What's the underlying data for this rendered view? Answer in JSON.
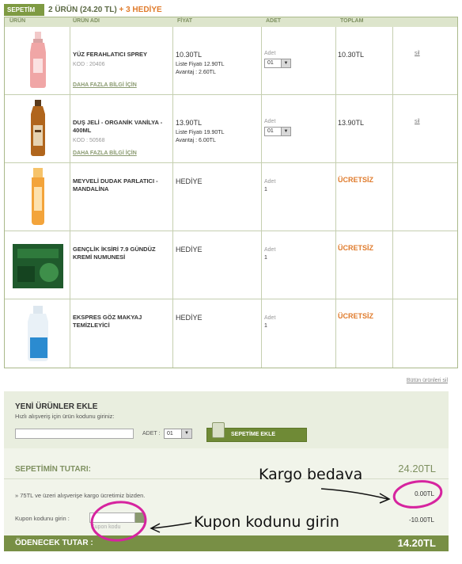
{
  "cart_header": {
    "tag": "SEPETİM",
    "count_text": "2 ÜRÜN (24.20 TL)",
    "gift_text": " + 3 HEDİYE"
  },
  "columns": {
    "product": "ÜRÜN",
    "product_name": "ÜRÜN ADI",
    "price": "FİYAT",
    "quantity": "ADET",
    "total": "TOPLAM"
  },
  "items": [
    {
      "name": "YÜZ FERAHLATICI SPREY",
      "code": "KOD : 20406",
      "more": "DAHA FAZLA BİLGİ İÇİN",
      "price": "10.30TL",
      "list_price": "Liste Fiyatı 12.90TL",
      "advantage": "Avantaj : 2.60TL",
      "qty_label": "Adet",
      "qty": "01",
      "total": "10.30TL",
      "delete": "sil"
    },
    {
      "name": "DUŞ JELİ - ORGANİK VANİLYA - 400ML",
      "code": "KOD : 50568",
      "more": "DAHA FAZLA BİLGİ İÇİN",
      "price": "13.90TL",
      "list_price": "Liste Fiyatı 19.90TL",
      "advantage": "Avantaj : 6.00TL",
      "qty_label": "Adet",
      "qty": "01",
      "total": "13.90TL",
      "delete": "sil"
    },
    {
      "name": "MEYVELİ DUDAK PARLATICI - MANDALİNA",
      "price": "HEDİYE",
      "qty_label": "Adet",
      "qty": "1",
      "total": "ÜCRETSİZ"
    },
    {
      "name": "GENÇLİK İKSİRİ 7.9 GÜNDÜZ KREMİ NUMUNESİ",
      "price": "HEDİYE",
      "qty_label": "Adet",
      "qty": "1",
      "total": "ÜCRETSİZ"
    },
    {
      "name": "EKSPRES GÖZ MAKYAJ TEMİZLEYİCİ",
      "price": "HEDİYE",
      "qty_label": "Adet",
      "qty": "1",
      "total": "ÜCRETSİZ"
    }
  ],
  "clear_all": "Bütün ürünleri sil",
  "add_products": {
    "title": "YENİ ÜRÜNLER EKLE",
    "subtitle": "Hızlı alışveriş için ürün kodunu giriniz:",
    "qty_label": "ADET :",
    "qty_value": "01",
    "button": "SEPETİME EKLE"
  },
  "summary": {
    "title": "SEPETİMİN TUTARI:",
    "amount": "24.20TL",
    "cargo_text": "» 75TL ve üzeri alışverişe kargo ücretimiz bizden.",
    "cargo_amount": "0.00TL",
    "coupon_label": "Kupon kodunu girin :",
    "coupon_hint": "Kupon kodu",
    "coupon_amount": "-10.00TL"
  },
  "pay": {
    "label": "ÖDENECEK TUTAR :",
    "amount": "14.20TL"
  },
  "annotations": {
    "cargo": "Kargo bedava",
    "coupon": "Kupon kodunu girin"
  },
  "colors": {
    "brand_green": "#7e9a42",
    "gift_orange": "#e07b2c",
    "annotation_magenta": "#d6249f"
  }
}
